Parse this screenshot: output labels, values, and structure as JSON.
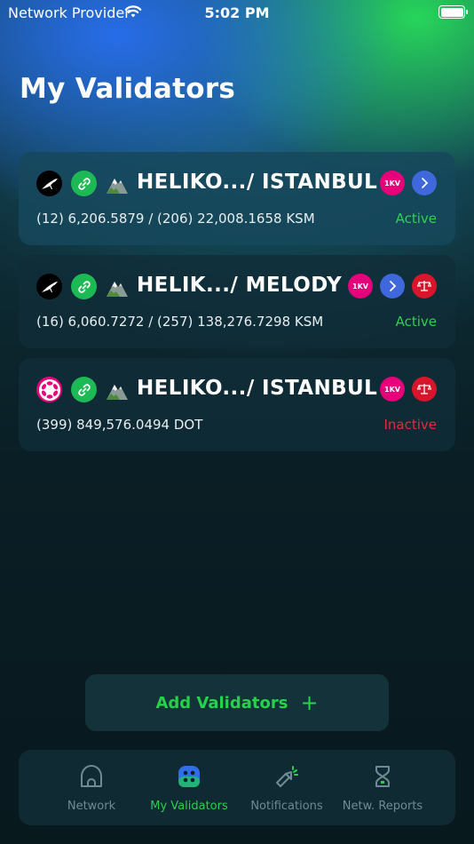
{
  "status_bar": {
    "carrier": "Network Provider",
    "time": "5:02 PM"
  },
  "page": {
    "title": "My Validators"
  },
  "validators": [
    {
      "chain_icon": "kusama-bird-icon",
      "name": "HELIKO.../ ISTANBUL",
      "badges": [
        "1KV",
        "chevron-right"
      ],
      "stake": "(12) 6,206.5879 / (206) 22,008.1658 KSM",
      "status": "Active"
    },
    {
      "chain_icon": "kusama-bird-icon",
      "name": "HELIK.../ MELODY",
      "badges": [
        "1KV",
        "chevron-right",
        "scale"
      ],
      "stake": "(16) 6,060.7272 / (257) 138,276.7298 KSM",
      "status": "Active"
    },
    {
      "chain_icon": "polkadot-icon",
      "name": "HELIKO.../ ISTANBUL",
      "badges": [
        "1KV",
        "scale"
      ],
      "stake": "(399) 849,576.0494 DOT",
      "status": "Inactive"
    }
  ],
  "badge_text": {
    "onekv": "1KV"
  },
  "add_button": {
    "label": "Add Validators",
    "plus": "+"
  },
  "tab_bar": {
    "tabs": [
      {
        "label": "Network",
        "icon": "home-icon",
        "selected": false
      },
      {
        "label": "My Validators",
        "icon": "dice-icon",
        "selected": true
      },
      {
        "label": "Notifications",
        "icon": "flashlight-icon",
        "selected": false
      },
      {
        "label": "Netw. Reports",
        "icon": "hourglass-icon",
        "selected": false
      }
    ]
  },
  "colors": {
    "active": "#2fd14e",
    "inactive": "#e8283d",
    "accent_green": "#26d24b",
    "polkadot_pink": "#e6007a",
    "chevron_blue": "#3e68dc",
    "scale_red": "#d9152b"
  }
}
